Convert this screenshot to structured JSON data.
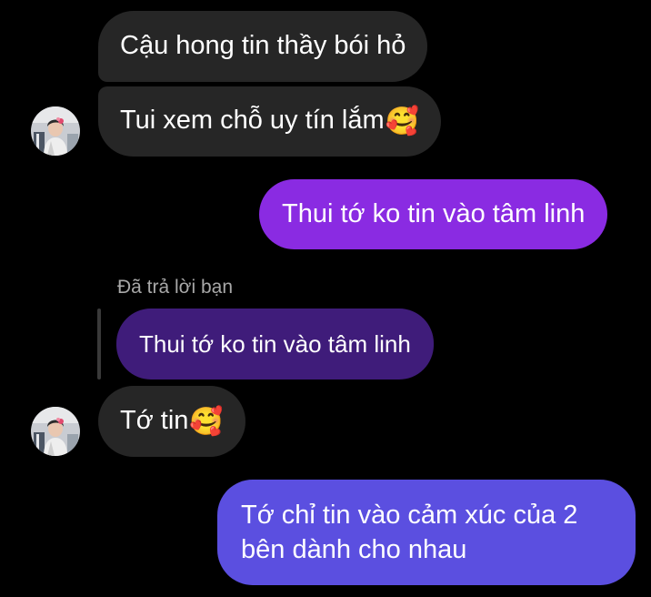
{
  "colors": {
    "background": "#000000",
    "incoming_bubble": "#262626",
    "outgoing_purple": "#8a2be2",
    "outgoing_indigo": "#5b4fe0",
    "quoted_bubble": "#3f1c7a",
    "meta_text": "#a8a8a8"
  },
  "messages": [
    {
      "text": "Cậu hong tin thầy bói hỏ",
      "emoji": ""
    },
    {
      "text": "Tui xem chỗ uy tín lắm",
      "emoji": "🥰",
      "emoji_icon": "smiling-face-with-hearts-icon"
    },
    {
      "text": "Thui tớ ko tin vào tâm linh"
    },
    {
      "text": "Tớ tin",
      "emoji": "🥰",
      "emoji_icon": "smiling-face-with-hearts-icon"
    },
    {
      "line1": "Tớ chỉ tin vào cảm xúc của 2",
      "line2": "bên dành cho nhau"
    }
  ],
  "reply": {
    "label": "Đã trả lời bạn",
    "quoted_text": "Thui tớ ko tin vào tâm linh"
  },
  "avatar_icon": "contact-avatar-icon"
}
